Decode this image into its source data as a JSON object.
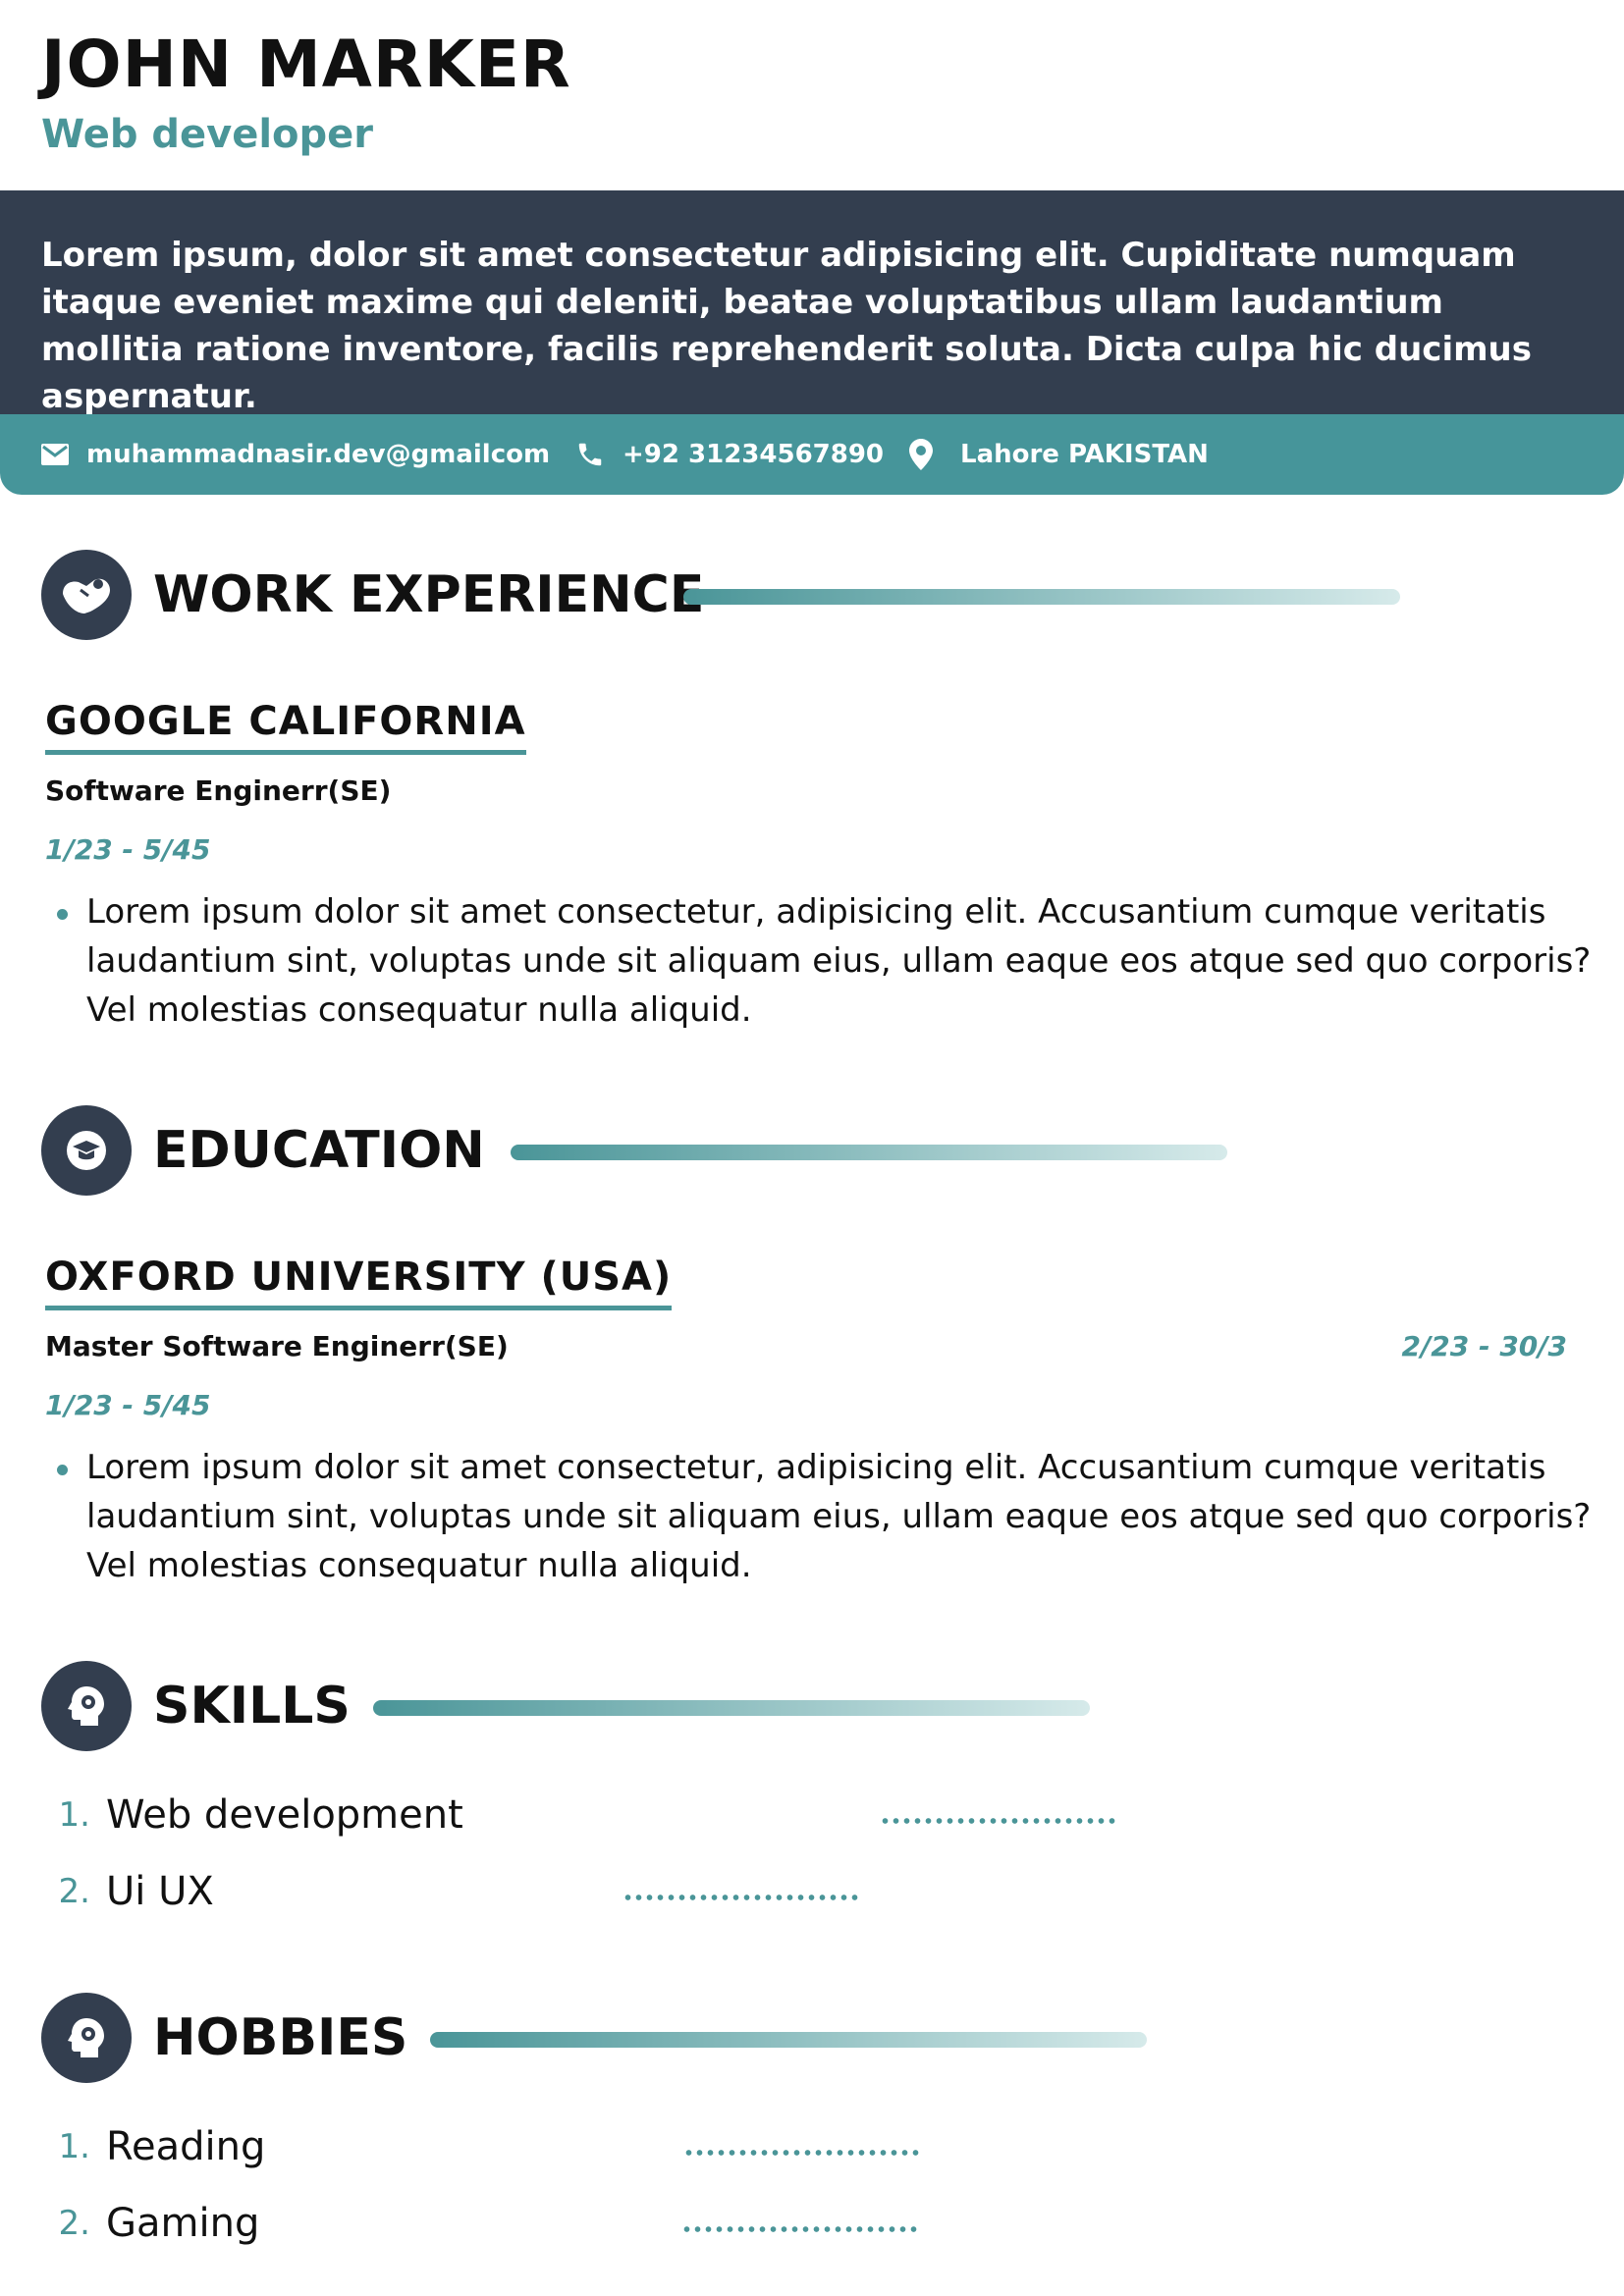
{
  "header": {
    "name": "JOHN MARKER",
    "role": "Web developer"
  },
  "summary": "Lorem ipsum, dolor sit amet consectetur adipisicing elit. Cupiditate numquam itaque eveniet maxime qui deleniti, beatae voluptatibus ullam laudantium mollitia ratione inventore, facilis reprehenderit soluta. Dicta culpa hic ducimus aspernatur.",
  "contact": {
    "email": "muhammadnasir.dev@gmailcom",
    "phone": "+92 31234567890",
    "location": "Lahore PAKISTAN"
  },
  "work": {
    "title": "WORK EXPERIENCE",
    "icon": "handshake-icon",
    "company": "GOOGLE CALIFORNIA",
    "position": "Software Enginerr(SE)",
    "dates": "1/23 - 5/45",
    "bullet": "Lorem ipsum dolor sit amet consectetur, adipisicing elit. Accusantium cumque veritatis laudantium sint, voluptas unde sit aliquam eius, ullam eaque eos atque sed quo corporis? Vel molestias consequatur nulla aliquid."
  },
  "education": {
    "title": "EDUCATION",
    "icon": "graduation-cap-icon",
    "school": "OXFORD UNIVERSITY (USA)",
    "degree": "Master Software Enginerr(SE)",
    "side_dates": "2/23 - 30/3",
    "dates": "1/23 - 5/45",
    "bullet": "Lorem ipsum dolor sit amet consectetur, adipisicing elit. Accusantium cumque veritatis laudantium sint, voluptas unde sit aliquam eius, ullam eaque eos atque sed quo corporis? Vel molestias consequatur nulla aliquid."
  },
  "skills": {
    "title": "SKILLS",
    "icon": "brain-gear-icon",
    "items": [
      {
        "num": "1.",
        "label": "Web development"
      },
      {
        "num": "2.",
        "label": "Ui UX"
      }
    ]
  },
  "hobbies": {
    "title": "HOBBIES",
    "icon": "brain-gear-icon",
    "items": [
      {
        "num": "1.",
        "label": "Reading"
      },
      {
        "num": "2.",
        "label": "Gaming"
      }
    ]
  },
  "colors": {
    "accent": "#4a9598",
    "dark": "#333e4f"
  }
}
